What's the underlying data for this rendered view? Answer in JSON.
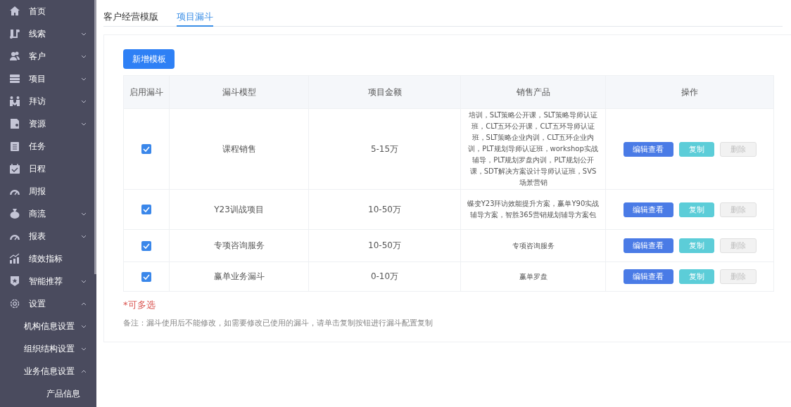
{
  "sidebar": {
    "items": [
      {
        "label": "首页"
      },
      {
        "label": "线索",
        "expanded": false
      },
      {
        "label": "客户",
        "expanded": false
      },
      {
        "label": "项目",
        "expanded": false
      },
      {
        "label": "拜访",
        "expanded": false
      },
      {
        "label": "资源",
        "expanded": false
      },
      {
        "label": "任务"
      },
      {
        "label": "日程"
      },
      {
        "label": "周报"
      },
      {
        "label": "商流",
        "expanded": false
      },
      {
        "label": "报表",
        "expanded": false
      },
      {
        "label": "绩效指标"
      },
      {
        "label": "智能推荐",
        "expanded": false
      },
      {
        "label": "设置",
        "expanded": true,
        "children": [
          {
            "label": "机构信息设置",
            "expanded": false
          },
          {
            "label": "组织结构设置",
            "expanded": false
          },
          {
            "label": "业务信息设置",
            "expanded": true,
            "children": [
              {
                "label": "产品信息"
              }
            ]
          }
        ]
      }
    ]
  },
  "tabs": [
    {
      "label": "客户经营模版",
      "selected": false
    },
    {
      "label": "项目漏斗",
      "selected": true
    }
  ],
  "add_button": "新增模板",
  "table": {
    "columns": [
      "启用漏斗",
      "漏斗模型",
      "项目金额",
      "销售产品",
      "操作"
    ],
    "rows": [
      {
        "enabled": true,
        "model": "课程销售",
        "amount": "5-15万",
        "products": "培训，SLT策略公开课，SLT策略导师认证班，CLT五环公开课，CLT五环导师认证班，SLT策略企业内训，CLT五环企业内训，PLT规划导师认证班，workshop实战辅导，PLT规划罗盘内训，PLT规划公开课，SDT解决方案设计导师认证班，SVS场景营销",
        "actions": [
          {
            "label": "编辑查看",
            "kind": "edit",
            "disabled": false
          },
          {
            "label": "复制",
            "kind": "copy",
            "disabled": false
          },
          {
            "label": "删除",
            "kind": "delete",
            "disabled": true
          }
        ]
      },
      {
        "enabled": true,
        "model": "Y23训战项目",
        "amount": "10-50万",
        "products": "蝶变Y23拜访效能提升方案，赢单Y90实战辅导方案，智胜365营销规划辅导方案包",
        "actions": [
          {
            "label": "编辑查看",
            "kind": "edit",
            "disabled": false
          },
          {
            "label": "复制",
            "kind": "copy",
            "disabled": false
          },
          {
            "label": "删除",
            "kind": "delete",
            "disabled": true
          }
        ]
      },
      {
        "enabled": true,
        "model": "专项咨询服务",
        "amount": "10-50万",
        "products": "专项咨询服务",
        "actions": [
          {
            "label": "编辑查看",
            "kind": "edit",
            "disabled": false
          },
          {
            "label": "复制",
            "kind": "copy",
            "disabled": false
          },
          {
            "label": "删除",
            "kind": "delete",
            "disabled": true
          }
        ]
      },
      {
        "enabled": true,
        "model": "赢单业务漏斗",
        "amount": "0-10万",
        "products": "赢单罗盘",
        "actions": [
          {
            "label": "编辑查看",
            "kind": "edit",
            "disabled": false
          },
          {
            "label": "复制",
            "kind": "copy",
            "disabled": false
          },
          {
            "label": "删除",
            "kind": "delete",
            "disabled": true
          }
        ]
      }
    ]
  },
  "multi_note": "*可多选",
  "remark": "备注：漏斗使用后不能修改，如需要修改已使用的漏斗，请单击复制按钮进行漏斗配置复制"
}
